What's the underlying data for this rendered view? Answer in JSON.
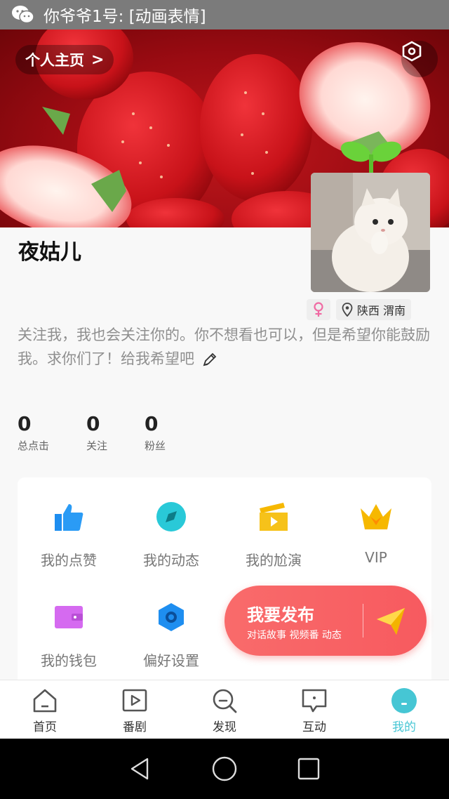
{
  "status_bar": {
    "app_icon": "wechat-icon",
    "text": "你爷爷1号: [动画表情]"
  },
  "header": {
    "home_label": "个人主页",
    "home_chevron": ">",
    "settings_icon": "hexagon-settings-icon"
  },
  "profile": {
    "name": "夜姑儿",
    "gender_icon": "female-icon",
    "location": "陕西 渭南",
    "bio": "关注我，我也会关注你的。你不想看也可以，但是希望你能鼓励我。求你们了！给我希望吧",
    "edit_icon": "pencil-icon"
  },
  "stats": [
    {
      "value": "0",
      "label": "总点击"
    },
    {
      "value": "0",
      "label": "关注"
    },
    {
      "value": "0",
      "label": "粉丝"
    }
  ],
  "menu": [
    {
      "label": "我的点赞",
      "icon": "thumbs-up-icon",
      "color": "#1e8ef0"
    },
    {
      "label": "我的动态",
      "icon": "compass-icon",
      "color": "#29c9d8"
    },
    {
      "label": "我的尬演",
      "icon": "clapperboard-icon",
      "color": "#f6b800"
    },
    {
      "label": "VIP",
      "icon": "crown-icon",
      "color": "#f6b800"
    },
    {
      "label": "我的钱包",
      "icon": "wallet-icon",
      "color": "#d56af0"
    },
    {
      "label": "偏好设置",
      "icon": "hexagon-gear-icon",
      "color": "#1e8ef0"
    }
  ],
  "publish": {
    "title": "我要发布",
    "subtitle": "对话故事 视频番 动态",
    "icon": "paper-plane-icon"
  },
  "tabs": [
    {
      "label": "首页",
      "icon": "home-icon"
    },
    {
      "label": "番剧",
      "icon": "play-square-icon"
    },
    {
      "label": "发现",
      "icon": "search-icon"
    },
    {
      "label": "互动",
      "icon": "chat-bubble-icon"
    },
    {
      "label": "我的",
      "icon": "profile-icon",
      "active": true
    }
  ],
  "colors": {
    "accent": "#46c6d4",
    "publish": "#f75a5f"
  }
}
